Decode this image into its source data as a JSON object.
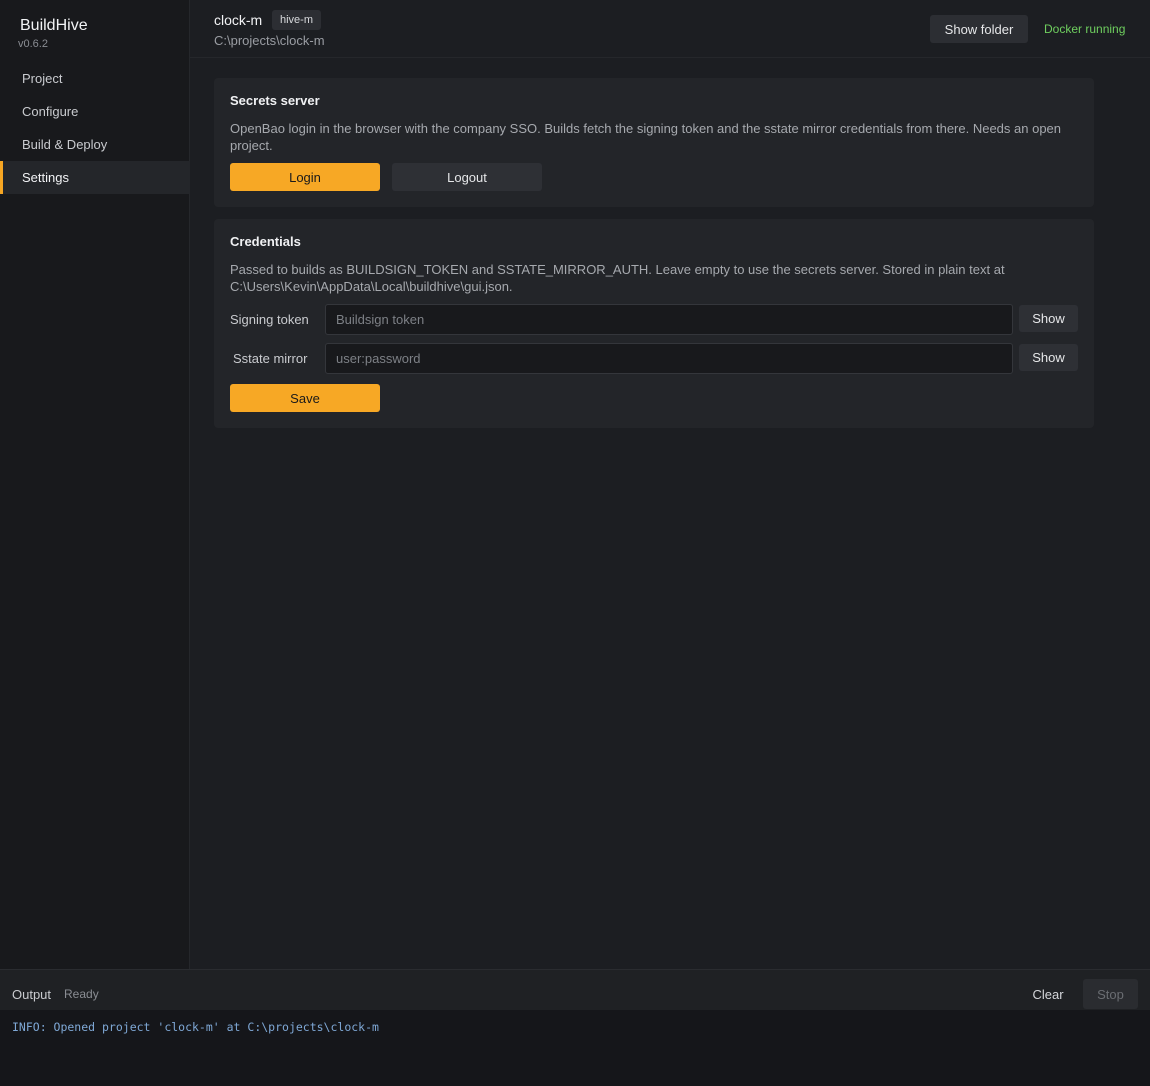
{
  "app": {
    "name": "BuildHive",
    "version": "v0.6.2"
  },
  "sidebar": {
    "items": [
      {
        "label": "Project"
      },
      {
        "label": "Configure"
      },
      {
        "label": "Build & Deploy"
      },
      {
        "label": "Settings",
        "active": true
      }
    ]
  },
  "header": {
    "project_name": "clock-m",
    "project_badge": "hive-m",
    "project_path": "C:\\projects\\clock-m",
    "show_folder_label": "Show folder",
    "docker_status": "Docker running",
    "docker_status_color": "#6fcf5f"
  },
  "secrets_server": {
    "title": "Secrets server",
    "description": "OpenBao login in the browser with the company SSO. Builds fetch the signing token and the sstate mirror credentials from there. Needs an open project.",
    "login_label": "Login",
    "logout_label": "Logout"
  },
  "credentials": {
    "title": "Credentials",
    "description": "Passed to builds as BUILDSIGN_TOKEN and SSTATE_MIRROR_AUTH. Leave empty to use the secrets server. Stored in plain text at C:\\Users\\Kevin\\AppData\\Local\\buildhive\\gui.json.",
    "signing_token": {
      "label": "Signing token",
      "value": "",
      "placeholder": "Buildsign token",
      "show_label": "Show"
    },
    "sstate_mirror": {
      "label": "Sstate mirror",
      "value": "",
      "placeholder": "user:password",
      "show_label": "Show"
    },
    "save_label": "Save"
  },
  "output": {
    "label": "Output",
    "status": "Ready",
    "clear_label": "Clear",
    "stop_label": "Stop",
    "log": [
      "INFO: Opened project 'clock-m' at C:\\projects\\clock-m"
    ]
  },
  "colors": {
    "accent": "#f7a825",
    "background": "#1c1e22",
    "sidebar": "#18191c",
    "card": "#232529"
  }
}
